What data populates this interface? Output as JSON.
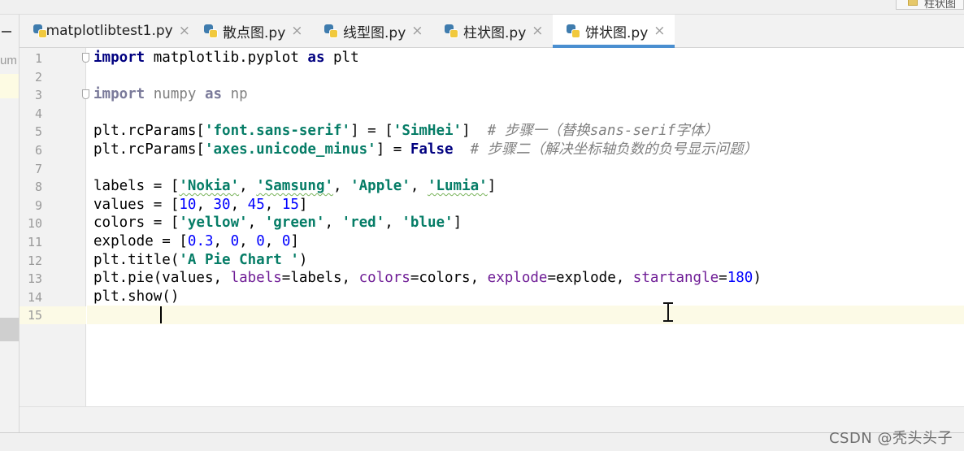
{
  "window": {
    "corner_tab_label": "柱状图"
  },
  "sidebar": {
    "truncated_label": "um"
  },
  "tabs": [
    {
      "label": "matplotlibtest1.py",
      "close": "×",
      "active": false
    },
    {
      "label": "散点图.py",
      "close": "×",
      "active": false
    },
    {
      "label": "线型图.py",
      "close": "×",
      "active": false
    },
    {
      "label": "柱状图.py",
      "close": "×",
      "active": false
    },
    {
      "label": "饼状图.py",
      "close": "×",
      "active": true
    }
  ],
  "editor": {
    "line_numbers": [
      "1",
      "2",
      "3",
      "4",
      "5",
      "6",
      "7",
      "8",
      "9",
      "10",
      "11",
      "12",
      "13",
      "14",
      "15"
    ],
    "current_line": 15,
    "code": {
      "l1": {
        "kw1": "import",
        "mod": " matplotlib.pyplot ",
        "kw2": "as",
        "alias": " plt"
      },
      "l3": {
        "kw1": "import",
        "mod": " numpy ",
        "kw2": "as",
        "alias": " np"
      },
      "l5": {
        "pre": "plt.rcParams[",
        "key": "'font.sans-serif'",
        "mid": "] = [",
        "val": "'SimHei'",
        "post": "]  ",
        "comment": "# 步骤一（替换sans-serif字体）"
      },
      "l6": {
        "pre": "plt.rcParams[",
        "key": "'axes.unicode_minus'",
        "mid": "] = ",
        "val": "False",
        "post": "  ",
        "comment": "# 步骤二（解决坐标轴负数的负号显示问题）"
      },
      "l8": {
        "pre": "labels = [",
        "s1": "'Nokia'",
        "c1": ", ",
        "s2": "'Samsung'",
        "c2": ", ",
        "s3": "'Apple'",
        "c3": ", ",
        "s4": "'Lumia'",
        "post": "]"
      },
      "l9": {
        "pre": "values = [",
        "n1": "10",
        "c1": ", ",
        "n2": "30",
        "c2": ", ",
        "n3": "45",
        "c3": ", ",
        "n4": "15",
        "post": "]"
      },
      "l10": {
        "pre": "colors = [",
        "s1": "'yellow'",
        "c1": ", ",
        "s2": "'green'",
        "c2": ", ",
        "s3": "'red'",
        "c3": ", ",
        "s4": "'blue'",
        "post": "]"
      },
      "l11": {
        "pre": "explode = [",
        "n1": "0.3",
        "c1": ", ",
        "n2": "0",
        "c2": ", ",
        "n3": "0",
        "c3": ", ",
        "n4": "0",
        "post": "]"
      },
      "l12": {
        "pre": "plt.title(",
        "s1": "'A Pie Chart '",
        "post": ")"
      },
      "l13": {
        "pre": "plt.pie(values, ",
        "p1": "labels",
        "a1": "=labels, ",
        "p2": "colors",
        "a2": "=colors, ",
        "p3": "explode",
        "a3": "=explode, ",
        "p4": "startangle",
        "a4": "=",
        "n1": "180",
        "post": ")"
      },
      "l14": {
        "text": "plt.show()"
      }
    }
  },
  "watermark": "CSDN @秃头头子"
}
